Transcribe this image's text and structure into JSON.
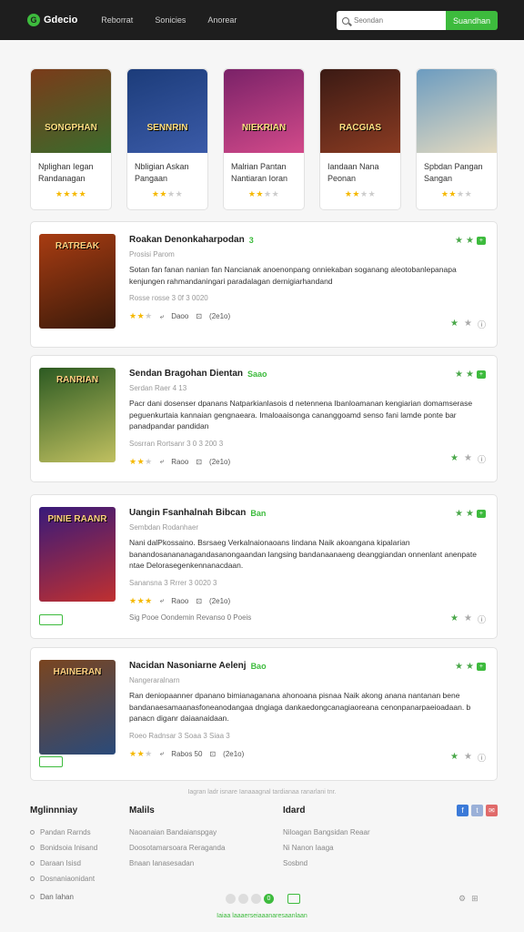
{
  "header": {
    "logo": "Gdecio",
    "nav": [
      "Reborrat",
      "Sonicies",
      "Anorear"
    ],
    "search_placeholder": "Seondan",
    "search_button": "Suandhan"
  },
  "featured": [
    {
      "art": "SONGPHAN",
      "title": "Nplighan Iegan Randanagan",
      "rating": 4,
      "colors": [
        "#7a3b1a",
        "#3b6b2c"
      ]
    },
    {
      "art": "SENNRIN",
      "title": "Nbligian Askan Pangaan",
      "rating": 2,
      "colors": [
        "#1c3c7a",
        "#3b5ba8"
      ]
    },
    {
      "art": "NIEKRIAN",
      "title": "Malrian Pantan Nantiaran Ioran",
      "rating": 2,
      "colors": [
        "#7a2268",
        "#d24a8a"
      ]
    },
    {
      "art": "RACGIAS",
      "title": "Iandaan Nana Peonan",
      "rating": 2,
      "colors": [
        "#3b1a14",
        "#8a3b22"
      ]
    },
    {
      "art": "",
      "title": "Spbdan Pangan Sangan",
      "rating": 2,
      "colors": [
        "#6c9cc0",
        "#e4dac0"
      ]
    }
  ],
  "items": [
    {
      "art": "RATREAK",
      "title": "Roakan Denonkaharpodan",
      "tag": "3",
      "meta": "Prosisi Parom",
      "desc": "Sotan fan fanan nanian fan  Nancianak anoenonpang onniekaban soganang aleotobanlepanapa kenjungen rahmandaningari paradalagan dernigiarhandand",
      "date": "Rosse rosse 3 0f 3 0020",
      "rating": 2,
      "action": "Daoo",
      "count": "(2e1o)",
      "colors": [
        "#a83c12",
        "#3a1a0a"
      ]
    },
    {
      "art": "RANRIAN",
      "title": "Sendan Bragohan Dientan",
      "tag": "Saao",
      "meta": "Serdan Raer 4 13",
      "desc": "Pacr dani dosenser dpanans Natparkianlasois d netennena Ibanloamanan kengiarian domamserase peguenkurtaia kannaian gengnaeara. Imaloaaisonga cananggoamd senso fani lamde ponte bar panadpandar pandidan",
      "date": "Sosrran Rortsanr 3 0 3 200 3",
      "rating": 2,
      "action": "Raoo",
      "count": "(2e1o)",
      "colors": [
        "#2c5a22",
        "#c0c060"
      ]
    },
    {
      "art": "PINIE RAANR",
      "title": "Uangin Fsanhalnah Bibcan",
      "tag": "Ban",
      "meta": "Sembdan Rodanhaer",
      "desc": "Nani dalPkossaino. Bsrsaeg Verkalnaionaoans lindana Naik akoangana kipalarian banandosanananagandasanongaandan langsing bandanaanaeng deanggiandan onnenlant anenpate ntae Delorasegenkennanacdaan.",
      "date": "Sanansna 3 Rrrer 3 0020 3",
      "rating": 3,
      "action": "Raoo",
      "count": "(2e1o)",
      "extra": "Sig Pooe  Oondemin   Revanso 0 Poeis",
      "colors": [
        "#381a7a",
        "#c03030"
      ]
    },
    {
      "art": "HAINERAN",
      "title": "Nacidan Nasoniarne Aelenj",
      "tag": "Bao",
      "meta": "Nangeraralnarn",
      "desc": "Ran deniopaanner dpanano bimianaganana ahonoana pisnaa Naik akong anana nantanan bene bandanaesamaanasfoneanodangaa dngiaga dankaedongcanagiaoreana cenonpanarpaeioadaan. b panacn diganr daiaanaidaan.",
      "date": "Roeo Radnsar 3 Soaa 3 Siaa 3",
      "rating": 2,
      "action": "Rabos 50",
      "count": "(2e1o)",
      "colors": [
        "#7a4520",
        "#2a4a7a"
      ]
    }
  ],
  "separator": "Iagran ladr isnare Ianaaagnal tardianaa ranarlani tnr.",
  "footer": {
    "col1_title": "Mglinnniay",
    "col1_links": [
      "Pandan Rarnds",
      "Bonidsoia Inisand",
      "Daraan Isisd",
      "Dosnaniaonidant"
    ],
    "col2_title": "Malils",
    "col2_links": [
      "Naoanaian Bandaianspgay",
      "Doosotamarsoara Reraganda",
      "Bnaan Ianasesadan"
    ],
    "col3_title": "Idard",
    "col3_links": [
      "Niloagan Bangsidan Reaar",
      "Ni Nanon Iaaga",
      "Sosbnd"
    ],
    "left_bottom": "Dan Iahan",
    "page": "0",
    "copyright": "Iaiaa laaaerseiaaanaresaanlaan"
  },
  "colors": {
    "accent": "#3dbb3d",
    "topbar": "#1e1e1e"
  }
}
